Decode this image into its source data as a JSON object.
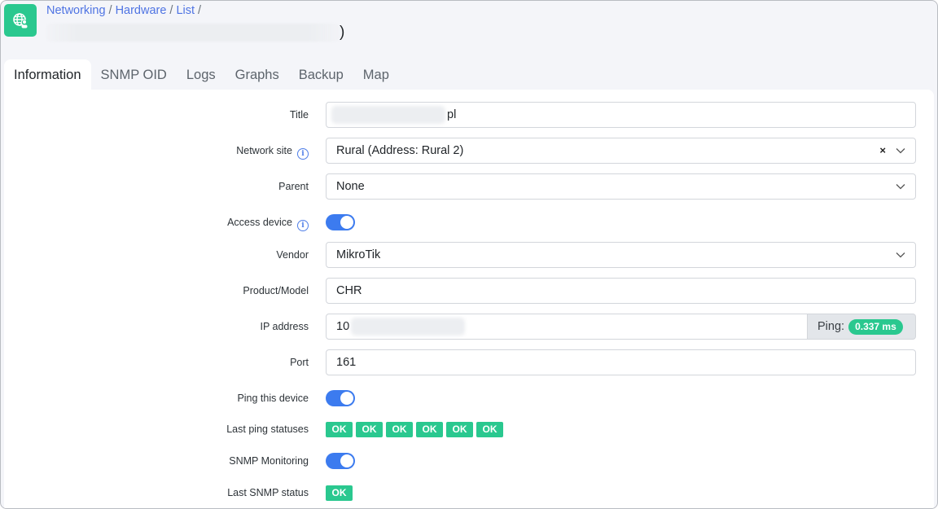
{
  "header": {
    "logo_icon": "globe-user-icon",
    "breadcrumb": [
      {
        "label": "Networking"
      },
      {
        "label": "Hardware"
      },
      {
        "label": "List"
      }
    ],
    "breadcrumb_separator": "/",
    "title_suffix": ")"
  },
  "tabs": [
    {
      "label": "Information",
      "active": true
    },
    {
      "label": "SNMP OID",
      "active": false
    },
    {
      "label": "Logs",
      "active": false
    },
    {
      "label": "Graphs",
      "active": false
    },
    {
      "label": "Backup",
      "active": false
    },
    {
      "label": "Map",
      "active": false
    }
  ],
  "form": {
    "title": {
      "label": "Title",
      "value_visible_suffix": "pl"
    },
    "network_site": {
      "label": "Network site",
      "value": "Rural (Address: Rural 2)",
      "clear_glyph": "×"
    },
    "parent": {
      "label": "Parent",
      "value": "None"
    },
    "access_device": {
      "label": "Access device",
      "enabled": true
    },
    "vendor": {
      "label": "Vendor",
      "value": "MikroTik"
    },
    "product_model": {
      "label": "Product/Model",
      "value": "CHR"
    },
    "ip_address": {
      "label": "IP address",
      "value_visible_prefix": "10",
      "ping_label": "Ping:",
      "ping_value": "0.337 ms"
    },
    "port": {
      "label": "Port",
      "value": "161"
    },
    "ping_this_device": {
      "label": "Ping this device",
      "enabled": true
    },
    "last_ping_statuses": {
      "label": "Last ping statuses",
      "statuses": [
        "OK",
        "OK",
        "OK",
        "OK",
        "OK",
        "OK"
      ]
    },
    "snmp_monitoring": {
      "label": "SNMP Monitoring",
      "enabled": true
    },
    "last_snmp_status": {
      "label": "Last SNMP status",
      "status": "OK"
    }
  },
  "colors": {
    "brand_green": "#2ac88f",
    "link_blue": "#4f74e3",
    "toggle_blue": "#3c7bef"
  }
}
